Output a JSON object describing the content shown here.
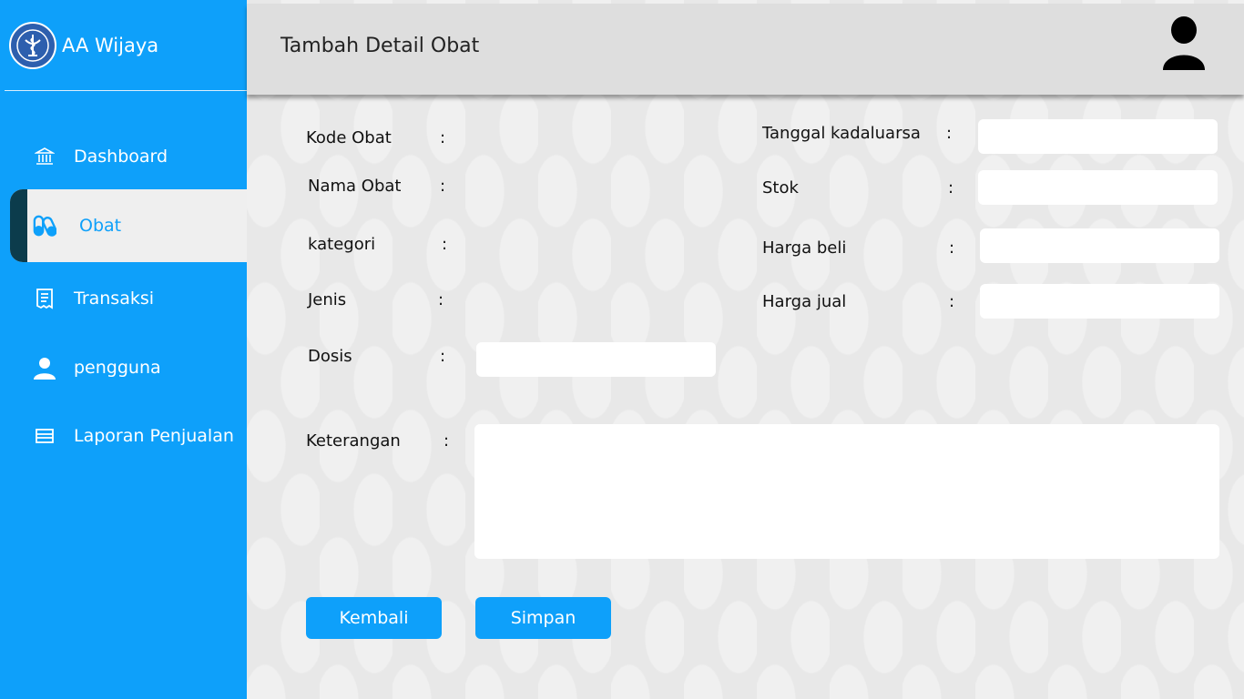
{
  "app": {
    "brand_name": "AA Wijaya",
    "logo_icon": "pharmacy-caduceus-icon"
  },
  "sidebar": {
    "items": [
      {
        "label": "Dashboard",
        "icon": "bank-icon",
        "active": false
      },
      {
        "label": "Obat",
        "icon": "pills-icon",
        "active": true
      },
      {
        "label": "Transaksi",
        "icon": "receipt-icon",
        "active": false
      },
      {
        "label": "pengguna",
        "icon": "user-icon",
        "active": false
      },
      {
        "label": "Laporan Penjualan",
        "icon": "report-icon",
        "active": false
      }
    ]
  },
  "header": {
    "title": "Tambah Detail Obat",
    "avatar_icon": "user-avatar-icon"
  },
  "form": {
    "colon": ":",
    "kode_obat": {
      "label": "Kode Obat",
      "value": ""
    },
    "nama_obat": {
      "label": "Nama Obat",
      "value": ""
    },
    "kategori": {
      "label": "kategori",
      "value": ""
    },
    "jenis": {
      "label": "Jenis",
      "value": ""
    },
    "dosis": {
      "label": "Dosis",
      "value": ""
    },
    "tanggal_kadaluarsa": {
      "label": "Tanggal kadaluarsa",
      "value": ""
    },
    "stok": {
      "label": "Stok",
      "value": ""
    },
    "harga_beli": {
      "label": "Harga beli",
      "value": ""
    },
    "harga_jual": {
      "label": "Harga  jual",
      "value": ""
    },
    "keterangan": {
      "label": "Keterangan",
      "value": ""
    }
  },
  "actions": {
    "back_label": "Kembali",
    "save_label": "Simpan"
  },
  "colors": {
    "primary": "#0ea0fa",
    "active_strip": "#0c3c4c",
    "header_bg": "#dedede"
  }
}
